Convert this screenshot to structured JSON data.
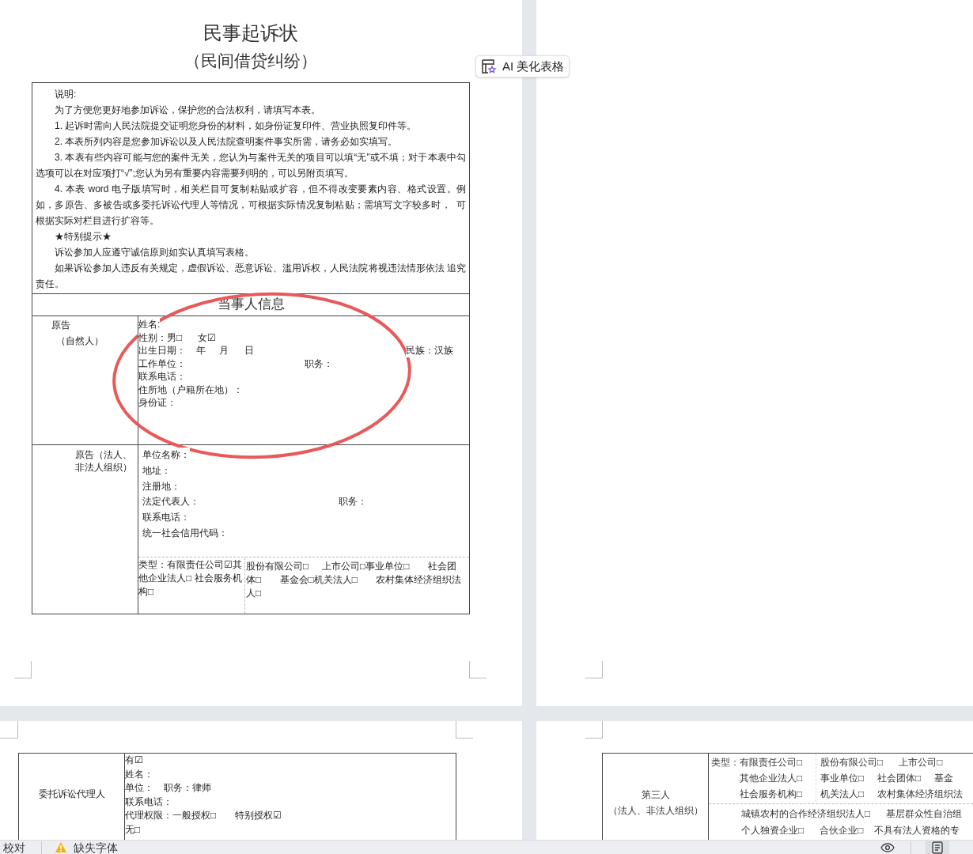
{
  "page_1": {
    "title": "民事起诉状",
    "subtitle": "（民间借贷纠纷）",
    "notes": [
      {
        "kind": "heading",
        "text": "说明:"
      },
      {
        "kind": "paragraph",
        "text": "为了方便您更好地参加诉讼，保护您的合法权利，请填写本表。"
      },
      {
        "kind": "paragraph",
        "text": "1. 起诉时需向人民法院提交证明您身份的材料，如身份证复印件、营业执照复印件等。"
      },
      {
        "kind": "paragraph",
        "text": "2. 本表所列内容是您参加诉讼以及人民法院查明案件事实所需，请务必如实填写。"
      },
      {
        "kind": "paragraph",
        "text": "3. 本表有些内容可能与您的案件无关，您认为与案件无关的项目可以填“无”或不填；对于本表中勾选项可以在对应项打“√”;您认为另有重要内容需要列明的，可以另附页填写。"
      },
      {
        "kind": "paragraph",
        "text": "4. 本表 word 电子版填写时，相关栏目可复制粘贴或扩容，但不得改变要素内容、格式设置。例如，多原告、多被告或多委托诉讼代理人等情况，可根据实际情况复制粘贴；需填写文字较多时，  可根据实际对栏目进行扩容等。"
      },
      {
        "kind": "heading",
        "text": "★特别提示★"
      },
      {
        "kind": "paragraph",
        "text": "诉讼参加人应遵守诚信原则如实认真填写表格。"
      },
      {
        "kind": "paragraph",
        "text": "如果诉讼参加人违反有关规定，虚假诉讼、恶意诉讼、滥用诉权，人民法院将视违法情形依法 追究责任。"
      }
    ],
    "section_header": "当事人信息",
    "plaintiff_person": {
      "label_lines": [
        "原告",
        "（自然人）"
      ],
      "lines": [
        [
          {
            "kind": "start",
            "text": "姓名:"
          }
        ],
        [
          {
            "kind": "start",
            "text": "性别：男□      女☑"
          }
        ],
        [
          {
            "kind": "start",
            "text": "出生日期：    年     月      日"
          },
          {
            "kind": "end",
            "text": "民族：汉族"
          }
        ],
        [
          {
            "kind": "start",
            "text": "工作单位："
          },
          {
            "kind": "middle",
            "text": "职务："
          }
        ],
        [
          {
            "kind": "start",
            "text": "联系电话："
          }
        ],
        [
          {
            "kind": "start",
            "text": "住所地（户籍所在地）："
          }
        ],
        [
          {
            "kind": "start",
            "text": "身份证："
          }
        ]
      ]
    },
    "plaintiff_org": {
      "label_lines": [
        "原告（法人、",
        "非法人组织）"
      ],
      "lines": [
        [
          {
            "kind": "start",
            "text": "单位名称："
          }
        ],
        [
          {
            "kind": "start",
            "text": "地址："
          }
        ],
        [
          {
            "kind": "start",
            "text": "注册地："
          }
        ],
        [
          {
            "kind": "start",
            "text": "法定代表人："
          },
          {
            "kind": "middle",
            "text": "职务："
          }
        ],
        [
          {
            "kind": "start",
            "text": "联系电话："
          }
        ],
        [
          {
            "kind": "start",
            "text": "统一社会信用代码："
          }
        ]
      ],
      "type_left": "类型：有限责任公司☑其他企业法人□ 社会服务机构□",
      "type_right": "股份有限公司□     上市公司□事业单位□       社会团体□       基金会□机关法人□       农村集体经济组织法人□"
    }
  },
  "ai_button": {
    "label": "AI 美化表格"
  },
  "page_3": {
    "agent": {
      "label": "委托诉讼代理人",
      "lines": [
        "有☑",
        "姓名：",
        "单位：    职务：律师",
        "联系电话：",
        "代理权限：一般授权□       特别授权☑",
        "无□"
      ]
    }
  },
  "page_4": {
    "third_party": {
      "label_lines": [
        "第三人",
        "（法人、非法人组织）"
      ],
      "type_label": "类型：",
      "type_left": [
        "有限责任公司□",
        "其他企业法人□",
        "社会服务机构□"
      ],
      "type_right": [
        "股份有限公司□      上市公司□",
        "事业单位□     社会团体□     基金",
        "机关法人□     农村集体经济组织法"
      ],
      "more_lines": [
        "城镇农村的合作经济组织法人□      基层群众性自治组",
        "个人独资企业□      合伙企业□    不具有法人资格的专"
      ]
    }
  },
  "status_bar": {
    "items": [
      "校对",
      "缺失字体"
    ]
  }
}
